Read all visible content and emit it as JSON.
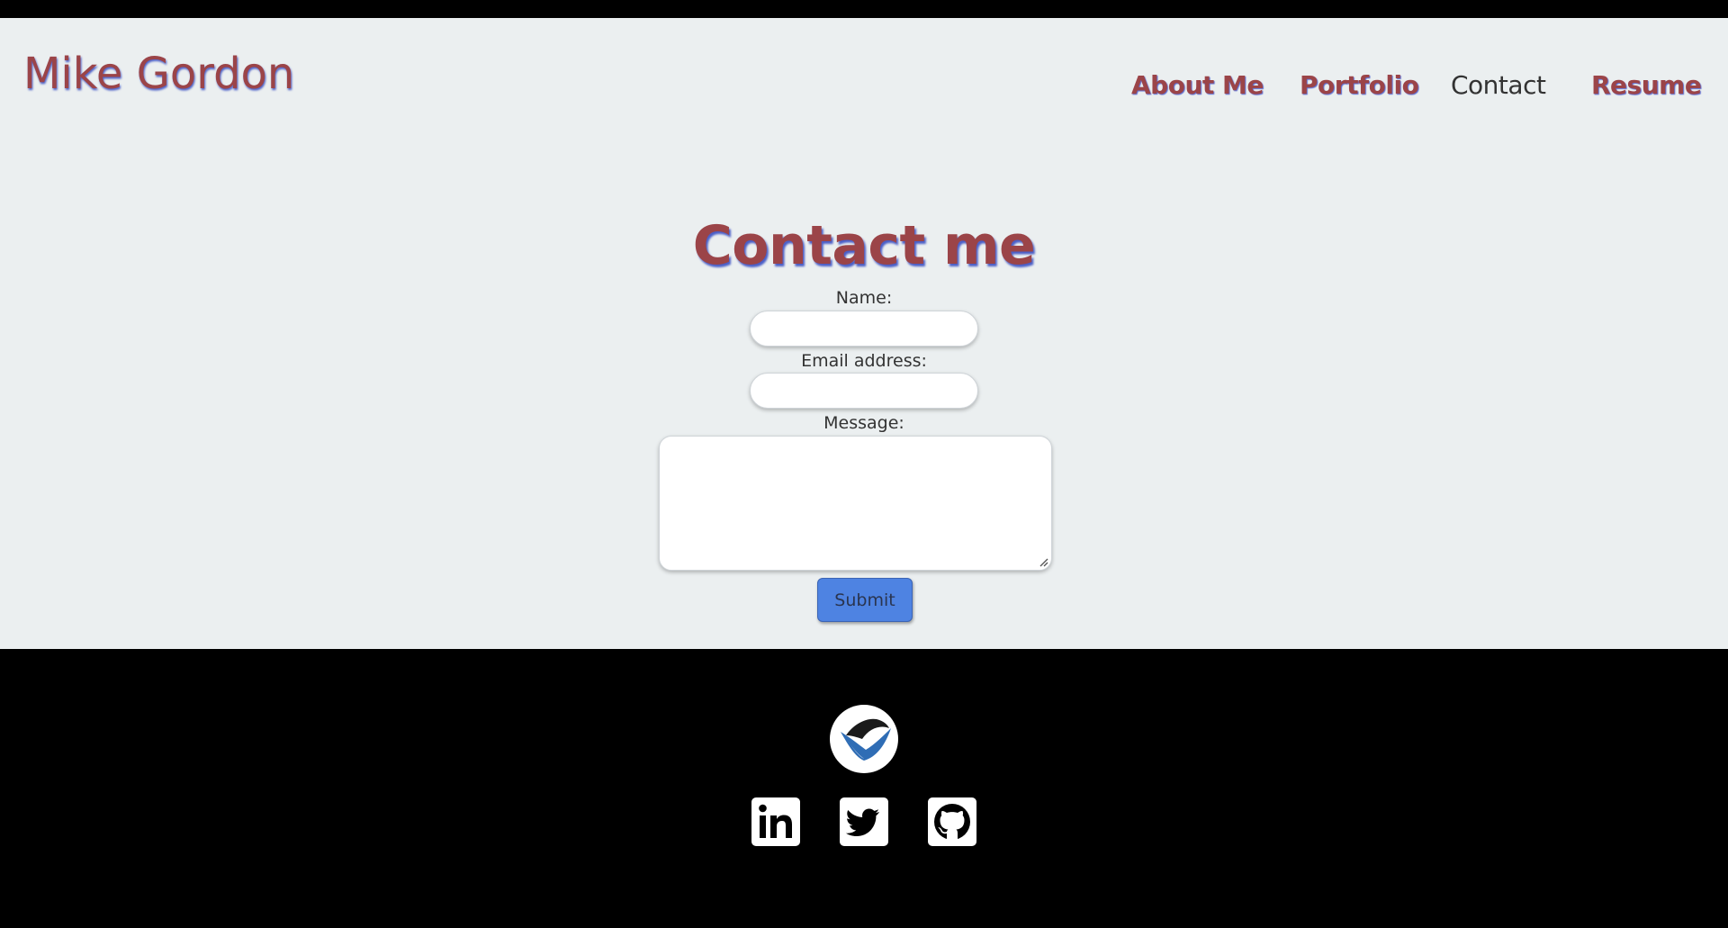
{
  "header": {
    "brand": "Mike Gordon",
    "nav": [
      {
        "label": "About Me",
        "active": false
      },
      {
        "label": "Portfolio",
        "active": false
      },
      {
        "label": "Contact",
        "active": true
      },
      {
        "label": "Resume",
        "active": false
      }
    ]
  },
  "contact": {
    "title": "Contact me",
    "name_label": "Name:",
    "name_value": "",
    "email_label": "Email address:",
    "email_value": "",
    "message_label": "Message:",
    "message_value": "",
    "submit_label": "Submit"
  },
  "footer": {
    "logo_icon": "circle-v-logo-icon",
    "social": [
      {
        "icon": "linkedin-icon"
      },
      {
        "icon": "twitter-icon"
      },
      {
        "icon": "github-icon"
      }
    ]
  },
  "colors": {
    "background": "#ebeff0",
    "brand": "#9b4448",
    "text_shadow": "#4a5ec7",
    "button": "#4e83e2",
    "footer": "#000000"
  }
}
